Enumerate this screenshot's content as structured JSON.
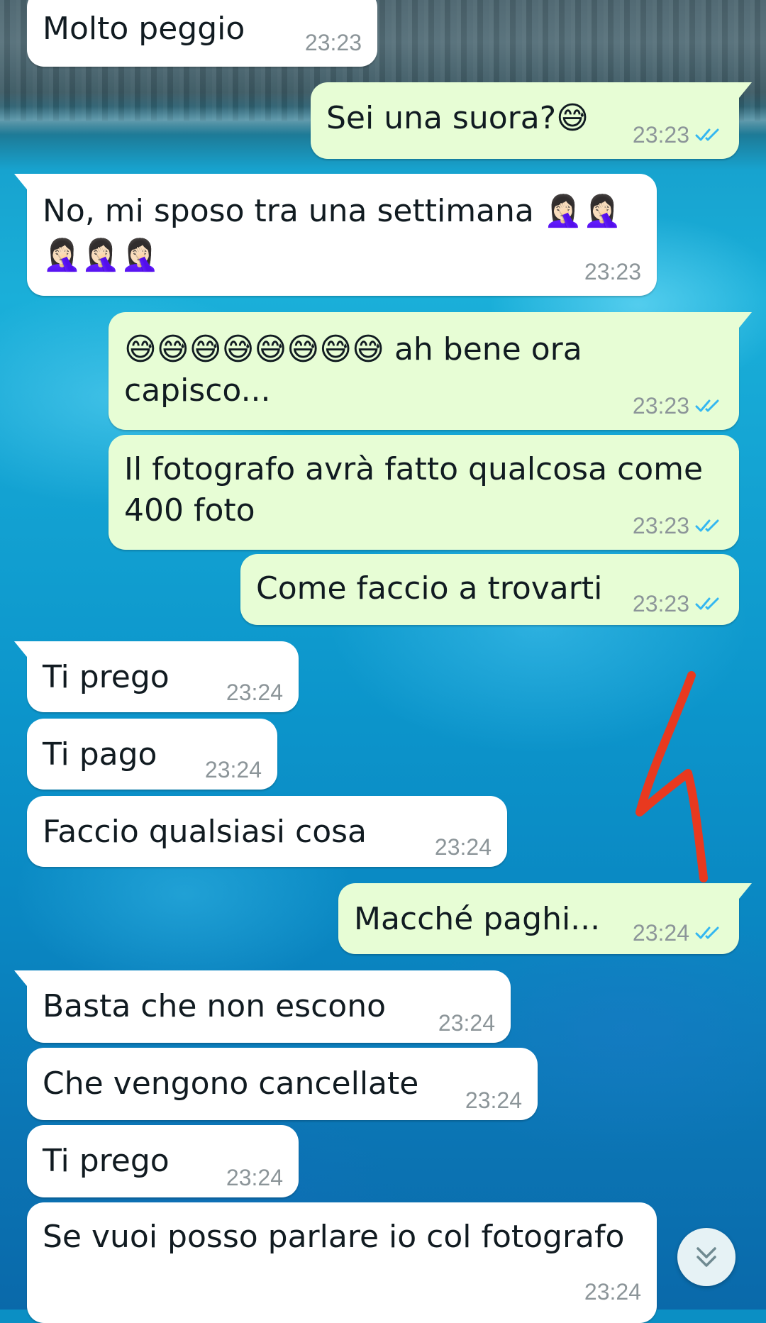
{
  "chat": {
    "messages": [
      {
        "dir": "in",
        "text": "Molto peggio",
        "time": "23:23"
      },
      {
        "dir": "out",
        "text": "Sei una suora?😅",
        "time": "23:23",
        "read": true
      },
      {
        "dir": "in",
        "text": "No, mi sposo tra una settimana 🤦🏻‍♀️🤦🏻‍♀️\n🤦🏻‍♀️🤦🏻‍♀️🤦🏻‍♀️",
        "time": "23:23"
      },
      {
        "dir": "out",
        "text": "😅😅😅😅😅😅😅😅 ah bene ora\ncapisco...",
        "time": "23:23",
        "read": true
      },
      {
        "dir": "out",
        "text": "Il fotografo avrà fatto qualcosa come\n400 foto",
        "time": "23:23",
        "read": true
      },
      {
        "dir": "out",
        "text": "Come faccio a trovarti",
        "time": "23:23",
        "read": true
      },
      {
        "dir": "in",
        "text": "Ti prego",
        "time": "23:24"
      },
      {
        "dir": "in",
        "text": "Ti pago",
        "time": "23:24"
      },
      {
        "dir": "in",
        "text": "Faccio qualsiasi cosa",
        "time": "23:24"
      },
      {
        "dir": "out",
        "text": "Macché paghi...",
        "time": "23:24",
        "read": true
      },
      {
        "dir": "in",
        "text": "Basta che non escono",
        "time": "23:24"
      },
      {
        "dir": "in",
        "text": "Che vengono cancellate",
        "time": "23:24"
      },
      {
        "dir": "in",
        "text": "Ti prego",
        "time": "23:24"
      },
      {
        "dir": "in",
        "text": "Se vuoi posso parlare io col fotografo",
        "time": "23:24"
      }
    ]
  },
  "colors": {
    "incoming_bubble": "#ffffff",
    "outgoing_bubble": "#e7fdd5",
    "read_ticks": "#34b7f1",
    "timestamp": "#8c9599",
    "annotation_stroke": "#e8391f"
  },
  "icons": {
    "read_receipt": "double-check-icon",
    "scroll_down": "double-chevron-down-icon"
  }
}
